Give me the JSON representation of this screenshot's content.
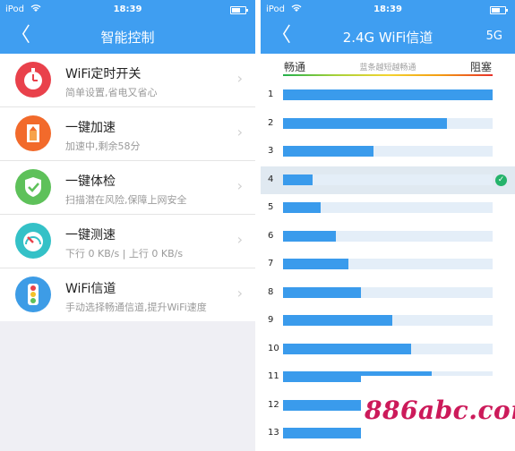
{
  "status": {
    "carrier": "iPod",
    "time": "18:39",
    "wifi_icon": "wifi-icon",
    "battery_icon": "battery-icon"
  },
  "left": {
    "title": "智能控制",
    "back_glyph": "〈",
    "items": [
      {
        "title": "WiFi定时开关",
        "subtitle": "简单设置,省电又省心",
        "icon": "stopwatch-icon",
        "color": "#e9414b"
      },
      {
        "title": "一键加速",
        "subtitle": "加速中,剩余58分",
        "icon": "boost-icon",
        "color": "#f26a2b"
      },
      {
        "title": "一键体检",
        "subtitle": "扫描潜在风险,保障上网安全",
        "icon": "shield-check-icon",
        "color": "#5ec15a"
      },
      {
        "title": "一键测速",
        "subtitle": "下行 0 KB/s | 上行 0 KB/s",
        "icon": "speedometer-icon",
        "color": "#34c1c7"
      },
      {
        "title": "WiFi信道",
        "subtitle": "手动选择畅通信道,提升WiFi速度",
        "icon": "traffic-light-icon",
        "color": "#3d9ce6"
      }
    ],
    "chevron": "›"
  },
  "right": {
    "title": "2.4G WiFi信道",
    "right_button": "5G",
    "back_glyph": "〈",
    "legend": {
      "left": "畅通",
      "middle": "蓝条越短越畅通",
      "right": "阻塞"
    },
    "selected_channel": 4,
    "check_glyph": "✓",
    "channels": [
      {
        "label": "1",
        "level": 1.0
      },
      {
        "label": "2",
        "level": 0.78
      },
      {
        "label": "3",
        "level": 0.43
      },
      {
        "label": "4",
        "level": 0.14
      },
      {
        "label": "5",
        "level": 0.18
      },
      {
        "label": "6",
        "level": 0.25
      },
      {
        "label": "7",
        "level": 0.31
      },
      {
        "label": "8",
        "level": 0.37
      },
      {
        "label": "9",
        "level": 0.52
      },
      {
        "label": "10",
        "level": 0.61
      },
      {
        "label": "11",
        "level": 0.71
      },
      {
        "label": "12",
        "level": 0.45
      },
      {
        "label": "13",
        "level": 0.38
      }
    ]
  },
  "watermark": "886abc.com",
  "colors": {
    "header": "#3f9ef1",
    "bar": "#3a9bec",
    "track": "#e4eef8",
    "selected_row": "#e0e9f1",
    "watermark": "#cc1a5a"
  }
}
